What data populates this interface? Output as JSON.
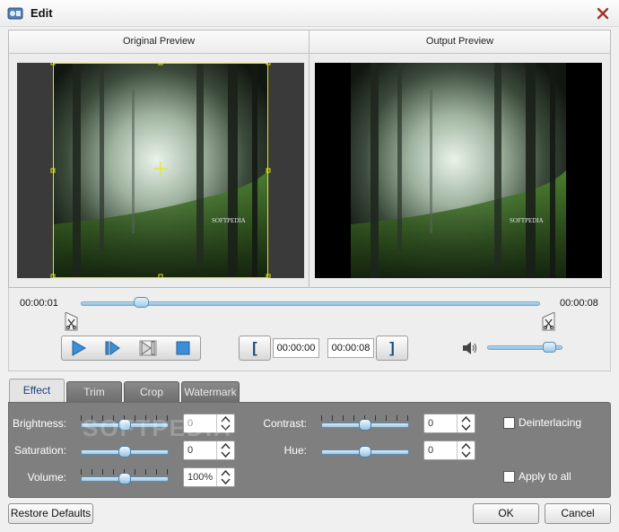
{
  "window": {
    "title": "Edit"
  },
  "preview": {
    "original_label": "Original Preview",
    "output_label": "Output Preview",
    "video_watermark": "SOFTPEDIA"
  },
  "timeline": {
    "current_time": "00:00:01",
    "end_time": "00:00:08",
    "position_fraction": 0.12
  },
  "playback": {
    "start_time": "00:00:00",
    "end_time": "00:00:08",
    "volume_fraction": 0.9
  },
  "tabs": [
    {
      "label": "Effect",
      "active": true
    },
    {
      "label": "Trim"
    },
    {
      "label": "Crop"
    },
    {
      "label": "Watermark"
    }
  ],
  "effect": {
    "brightness": {
      "label": "Brightness:",
      "value": "0",
      "level": 0.5
    },
    "saturation": {
      "label": "Saturation:",
      "value": "0",
      "level": 0.5
    },
    "volume": {
      "label": "Volume:",
      "value": "100%",
      "level": 0.5
    },
    "contrast": {
      "label": "Contrast:",
      "value": "0",
      "level": 0.5
    },
    "hue": {
      "label": "Hue:",
      "value": "0",
      "level": 0.5
    },
    "deinterlacing_label": "Deinterlacing",
    "apply_all_label": "Apply to all",
    "overlay_watermark": "SOFTPEDIA"
  },
  "buttons": {
    "restore": "Restore Defaults",
    "ok": "OK",
    "cancel": "Cancel"
  },
  "colors": {
    "accent": "#1e3f7a",
    "crop_frame": "#e8e800"
  }
}
